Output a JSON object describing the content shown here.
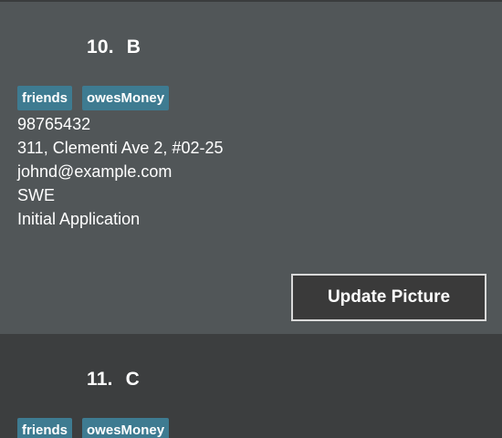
{
  "persons": [
    {
      "index": "10.",
      "name": "B",
      "tags": [
        "friends",
        "owesMoney"
      ],
      "phone": "98765432",
      "address": "311, Clementi Ave 2, #02-25",
      "email": "johnd@example.com",
      "role": "SWE",
      "status": "Initial Application",
      "update_button_label": "Update Picture"
    },
    {
      "index": "11.",
      "name": "C",
      "tags": [
        "friends",
        "owesMoney"
      ]
    }
  ],
  "colors": {
    "selected_card_bg": "#515658",
    "card_bg": "#3c3e3f",
    "tag_bg": "#3e7b91",
    "button_bg": "#3a3a3a",
    "button_border": "#d9d9d9",
    "text": "#ffffff"
  }
}
